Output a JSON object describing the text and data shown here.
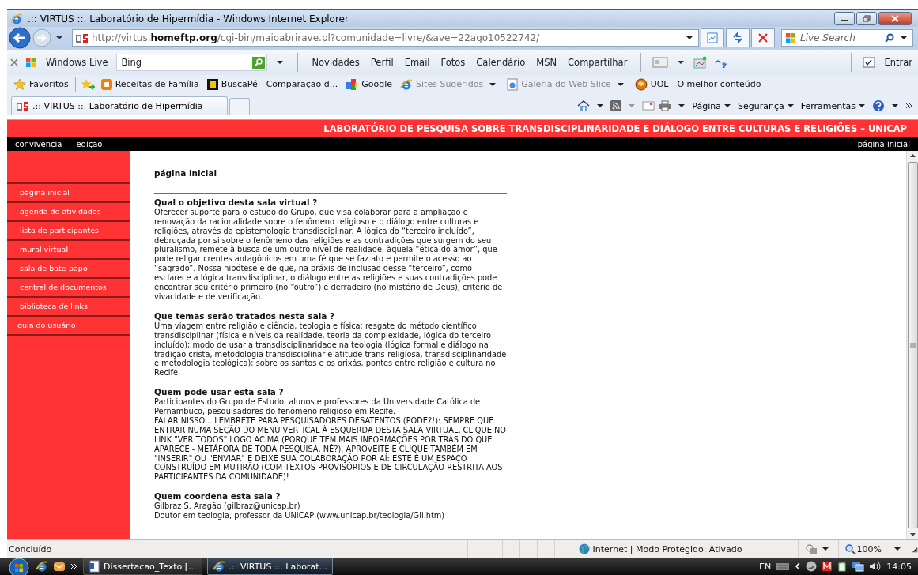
{
  "window": {
    "title": ".:: VIRTUS ::. Laboratório de Hipermídia - Windows Internet Explorer"
  },
  "address_bar": {
    "url": "http://virtus.**homeftp.org**/cgi-bin/maioabrirave.pl?comunidade=livre/&ave=22ago10522742/",
    "search_placeholder": "Live Search"
  },
  "live_toolbar": {
    "brand": "Windows Live",
    "search_value": "Bing",
    "links": [
      "Novidades",
      "Perfil",
      "Email",
      "Fotos",
      "Calendário",
      "MSN",
      "Compartilhar"
    ],
    "sign_in": "Entrar"
  },
  "favorites_bar": {
    "label": "Favoritos",
    "items": [
      {
        "label": "Receitas de Família",
        "kind": "blog",
        "disabled": false,
        "dropdown": false
      },
      {
        "label": "BuscaPé - Comparação d...",
        "kind": "letter",
        "disabled": false,
        "dropdown": false
      },
      {
        "label": "Google",
        "kind": "google",
        "disabled": false,
        "dropdown": false
      },
      {
        "label": "Sites Sugeridos",
        "kind": "ie",
        "disabled": true,
        "dropdown": true
      },
      {
        "label": "Galeria do Web Slice",
        "kind": "page",
        "disabled": true,
        "dropdown": true
      },
      {
        "label": "UOL - O melhor conteúdo",
        "kind": "uol",
        "disabled": false,
        "dropdown": false
      }
    ]
  },
  "tabs": [
    {
      "label": ".:: VIRTUS ::. Laboratório de Hipermídia",
      "selected": true
    }
  ],
  "command_bar": [
    "Página",
    "Segurança",
    "Ferramentas"
  ],
  "site": {
    "header": "LABORATÓRIO DE PESQUISA SOBRE TRANSDISCIPLINARIDADE E DIÁLOGO ENTRE CULTURAS E RELIGIÕES – UNICAP",
    "nav": [
      "convivência",
      "edição"
    ],
    "nav_right": "página inicial",
    "sidebar": [
      "página inicial",
      "agenda de atividades",
      "lista de participantes",
      "mural virtual",
      "sala de bate-papo",
      "central de documentos",
      "biblioteca de links",
      "guia do usuário"
    ],
    "page_title": "página inicial",
    "sections": [
      {
        "heading": "Qual o objetivo desta sala virtual ?",
        "paragraphs": [
          "Oferecer suporte para o estudo do Grupo, que visa colaborar para a ampliação e renovação da racionalidade sobre o fenômeno religioso e o diálogo entre culturas e religiões, através da epistemologia transdisciplinar. A lógica do “terceiro incluído”, debruçada por si sobre o fenômeno das religiões e as contradições que surgem do seu pluralismo, remete à busca de um outro nível de realidade, àquela “ética do amor”, que pode religar crentes antagônicos em uma fé que se faz ato e permite o acesso ao “sagrado”. Nossa hipótese é de que, na práxis de inclusão desse “terceiro”, como esclarece a lógica transdisciplinar, o diálogo entre as religiões e suas contradições pode encontrar seu critério primeiro (no “outro”) e derradeiro (no mistério de Deus), critério de vivacidade e de verificação."
        ]
      },
      {
        "heading": "Que temas serão tratados nesta sala ?",
        "paragraphs": [
          "Uma viagem entre religião e ciência, teologia e física; resgate do método científico transdisciplinar (física e níveis da realidade, teoria da complexidade, lógica do terceiro incluído); modo de usar a transdisciplinaridade na teologia (lógica formal e diálogo na tradição cristã, metodologia transdisciplinar e atitude trans-religiosa, transdisciplinaridade e metodologia teológica); sobre os santos e os orixás, pontes entre religião e cultura no Recife."
        ]
      },
      {
        "heading": "Quem pode usar esta sala ?",
        "paragraphs": [
          "Participantes do Grupo de Estudo, alunos e professores da Universidade Católica de Pernambuco, pesquisadores do fenômeno religioso em Recife.",
          "FALAR NISSO... LEMBRETE PARA PESQUISADORES DESATENTOS (PODE?!): SEMPRE QUE ENTRAR NUMA SEÇÃO DO MENU VERTICAL À ESQUERDA DESTA SALA VIRTUAL, CLIQUE NO LINK \"VER TODOS\" LOGO ACIMA (PORQUE TEM MAIS INFORMAÇÕES POR TRÁS DO QUE APARECE - METÁFORA DE TODA PESQUISA, NÉ?). APROVEITE E CLIQUE TAMBÉM EM \"INSERIR\" OU \"ENVIAR\" E DEIXE SUA COLABORAÇÃO POR AÍ: ESTE É UM ESPAÇO CONSTRUÍDO EM MUTIRÃO (COM TEXTOS PROVISÓRIOS E DE CIRCULAÇÃO RESTRITA AOS PARTICIPANTES DA COMUNIDADE)!"
        ]
      },
      {
        "heading": "Quem coordena esta sala ?",
        "paragraphs": [
          "Gilbraz S. Aragão (gilbraz@unicap.br)",
          "Doutor em teologia, professor da UNICAP (www.unicap.br/teologia/Gil.htm)"
        ]
      }
    ]
  },
  "status_bar": {
    "text": "Concluído",
    "zone": "Internet | Modo Protegido: Ativado",
    "zoom": "100%"
  },
  "taskbar": {
    "buttons": [
      {
        "label": "Dissertacao_Texto [...",
        "kind": "doc",
        "selected": false
      },
      {
        "label": ".:: VIRTUS ::. Laborat...",
        "kind": "ie",
        "selected": true
      }
    ],
    "language": "EN",
    "clock": "14:05"
  }
}
